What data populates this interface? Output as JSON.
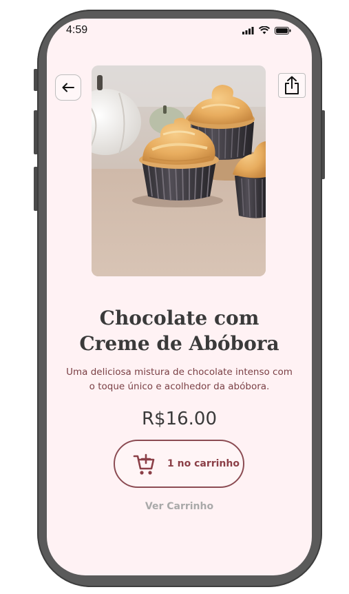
{
  "status_bar": {
    "time": "4:59"
  },
  "header": {
    "back_icon": "arrow-left-icon",
    "share_icon": "share-upload-icon"
  },
  "product": {
    "image_subject": "cupcakes-with-pumpkin-frosting",
    "title_line1": "Chocolate com",
    "title_line2": "Creme de Abóbora",
    "description_line1": "Uma deliciosa mistura de chocolate intenso com",
    "description_line2": "o toque único e acolhedor da abóbora.",
    "price": "R$16.00"
  },
  "cart": {
    "icon": "cart-plus-icon",
    "label": "1 no carrinho",
    "view_cart_label": "Ver Carrinho"
  },
  "colors": {
    "background": "#fff2f4",
    "accent": "#8b4b52",
    "title": "#3a3a3a",
    "muted": "#a9a9a9"
  }
}
